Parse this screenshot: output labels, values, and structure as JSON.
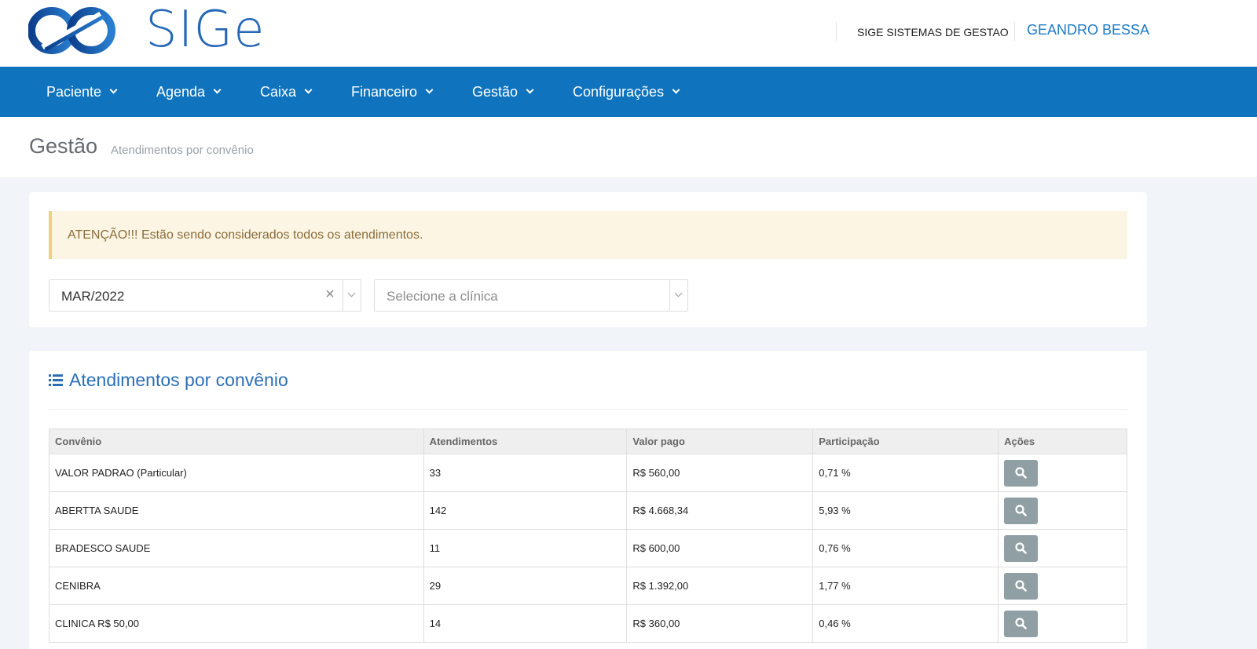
{
  "brand": {
    "logo_text": "SIGe"
  },
  "header": {
    "company": "SIGE SISTEMAS DE GESTAO",
    "user": "GEANDRO BESSA"
  },
  "nav": [
    {
      "label": "Paciente"
    },
    {
      "label": "Agenda"
    },
    {
      "label": "Caixa"
    },
    {
      "label": "Financeiro"
    },
    {
      "label": "Gestão"
    },
    {
      "label": "Configurações"
    }
  ],
  "page": {
    "title": "Gestão",
    "subtitle": "Atendimentos por convênio"
  },
  "alert": {
    "text": "ATENÇÃO!!! Estão sendo considerados todos os atendimentos."
  },
  "filters": {
    "period": {
      "value": "MAR/2022",
      "clear_symbol": "×"
    },
    "clinic": {
      "placeholder": "Selecione a clínica"
    }
  },
  "section": {
    "title": "Atendimentos por convênio"
  },
  "table": {
    "headers": [
      "Convênio",
      "Atendimentos",
      "Valor pago",
      "Participação",
      "Ações"
    ],
    "rows": [
      [
        "VALOR PADRAO (Particular)",
        "33",
        "R$ 560,00",
        "0,71 %"
      ],
      [
        "ABERTTA SAUDE",
        "142",
        "R$ 4.668,34",
        "5,93 %"
      ],
      [
        "BRADESCO SAUDE",
        "11",
        "R$ 600,00",
        "0,76 %"
      ],
      [
        "CENIBRA",
        "29",
        "R$ 1.392,00",
        "1,77 %"
      ],
      [
        "CLINICA R$ 50,00",
        "14",
        "R$ 360,00",
        "0,46 %"
      ]
    ]
  },
  "colors": {
    "nav_bg": "#0f74bd",
    "accent": "#1e7bc6",
    "alert_bg": "#fcf5e3",
    "alert_border": "#f4cf7a",
    "action_button": "#8f9fa3"
  }
}
